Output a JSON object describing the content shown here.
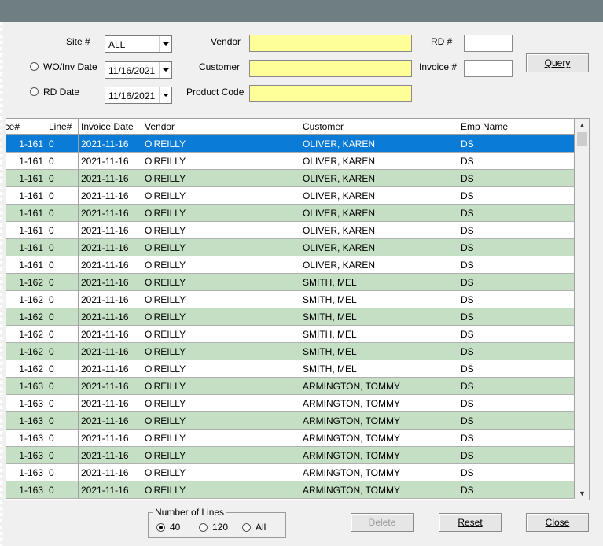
{
  "form": {
    "site_label": "Site #",
    "site_value": "ALL",
    "wo_inv_date_label": "WO/Inv Date",
    "wo_inv_date_value": "11/16/2021",
    "rd_date_label": "RD Date",
    "rd_date_value": "11/16/2021",
    "vendor_label": "Vendor",
    "customer_label": "Customer",
    "product_code_label": "Product Code",
    "rd_num_label": "RD #",
    "invoice_num_label": "Invoice #",
    "query_label": "Query"
  },
  "grid": {
    "columns": [
      "ice#",
      "Line#",
      "Invoice Date",
      "Vendor",
      "Customer",
      "Emp Name"
    ],
    "rows": [
      [
        "1-161",
        "0",
        "2021-11-16",
        "O'REILLY",
        "OLIVER, KAREN",
        "DS"
      ],
      [
        "1-161",
        "0",
        "2021-11-16",
        "O'REILLY",
        "OLIVER, KAREN",
        "DS"
      ],
      [
        "1-161",
        "0",
        "2021-11-16",
        "O'REILLY",
        "OLIVER, KAREN",
        "DS"
      ],
      [
        "1-161",
        "0",
        "2021-11-16",
        "O'REILLY",
        "OLIVER, KAREN",
        "DS"
      ],
      [
        "1-161",
        "0",
        "2021-11-16",
        "O'REILLY",
        "OLIVER, KAREN",
        "DS"
      ],
      [
        "1-161",
        "0",
        "2021-11-16",
        "O'REILLY",
        "OLIVER, KAREN",
        "DS"
      ],
      [
        "1-161",
        "0",
        "2021-11-16",
        "O'REILLY",
        "OLIVER, KAREN",
        "DS"
      ],
      [
        "1-161",
        "0",
        "2021-11-16",
        "O'REILLY",
        "OLIVER, KAREN",
        "DS"
      ],
      [
        "1-162",
        "0",
        "2021-11-16",
        "O'REILLY",
        "SMITH, MEL",
        "DS"
      ],
      [
        "1-162",
        "0",
        "2021-11-16",
        "O'REILLY",
        "SMITH, MEL",
        "DS"
      ],
      [
        "1-162",
        "0",
        "2021-11-16",
        "O'REILLY",
        "SMITH, MEL",
        "DS"
      ],
      [
        "1-162",
        "0",
        "2021-11-16",
        "O'REILLY",
        "SMITH, MEL",
        "DS"
      ],
      [
        "1-162",
        "0",
        "2021-11-16",
        "O'REILLY",
        "SMITH, MEL",
        "DS"
      ],
      [
        "1-162",
        "0",
        "2021-11-16",
        "O'REILLY",
        "SMITH, MEL",
        "DS"
      ],
      [
        "1-163",
        "0",
        "2021-11-16",
        "O'REILLY",
        "ARMINGTON, TOMMY",
        "DS"
      ],
      [
        "1-163",
        "0",
        "2021-11-16",
        "O'REILLY",
        "ARMINGTON, TOMMY",
        "DS"
      ],
      [
        "1-163",
        "0",
        "2021-11-16",
        "O'REILLY",
        "ARMINGTON, TOMMY",
        "DS"
      ],
      [
        "1-163",
        "0",
        "2021-11-16",
        "O'REILLY",
        "ARMINGTON, TOMMY",
        "DS"
      ],
      [
        "1-163",
        "0",
        "2021-11-16",
        "O'REILLY",
        "ARMINGTON, TOMMY",
        "DS"
      ],
      [
        "1-163",
        "0",
        "2021-11-16",
        "O'REILLY",
        "ARMINGTON, TOMMY",
        "DS"
      ],
      [
        "1-163",
        "0",
        "2021-11-16",
        "O'REILLY",
        "ARMINGTON, TOMMY",
        "DS"
      ]
    ],
    "selected_row": 0,
    "row_colors": {
      "even": "#c4dfc4",
      "odd": "#ffffff",
      "selected": "#0a7bd6"
    }
  },
  "number_of_lines": {
    "label": "Number of Lines",
    "options": [
      "40",
      "120",
      "All"
    ],
    "selected": "40"
  },
  "buttons": {
    "delete": "Delete",
    "reset": "Reset",
    "close": "Close"
  },
  "colors": {
    "title_bar": "#6f7e80",
    "required_field": "#ffff99"
  }
}
